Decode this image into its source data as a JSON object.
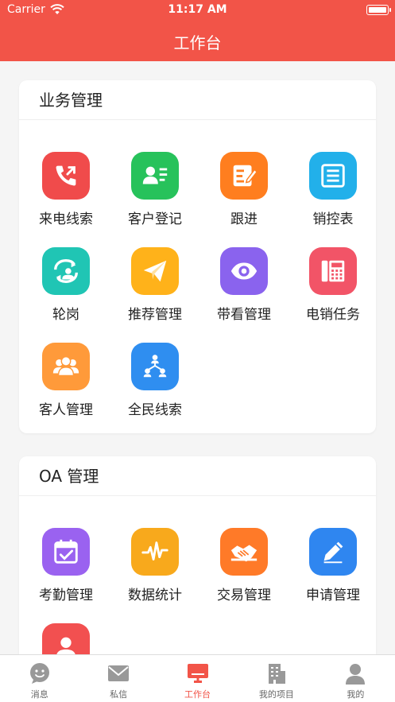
{
  "status": {
    "carrier": "Carrier",
    "time": "11:17 AM"
  },
  "header": {
    "title": "工作台"
  },
  "business": {
    "title": "业务管理",
    "items": [
      {
        "label": "来电线索",
        "icon": "phone-icon",
        "color": "#f04b4b"
      },
      {
        "label": "客户登记",
        "icon": "contact-card-icon",
        "color": "#27c25b"
      },
      {
        "label": "跟进",
        "icon": "edit-note-icon",
        "color": "#ff7e1f"
      },
      {
        "label": "销控表",
        "icon": "list-doc-icon",
        "color": "#22b0ea"
      },
      {
        "label": "轮岗",
        "icon": "rotate-user-icon",
        "color": "#20c5b4"
      },
      {
        "label": "推荐管理",
        "icon": "paper-plane-icon",
        "color": "#ffb21a"
      },
      {
        "label": "带看管理",
        "icon": "eye-icon",
        "color": "#8a63ee"
      },
      {
        "label": "电销任务",
        "icon": "desk-phone-icon",
        "color": "#f25467"
      },
      {
        "label": "客人管理",
        "icon": "group-icon",
        "color": "#ff9a3a"
      },
      {
        "label": "全民线索",
        "icon": "network-icon",
        "color": "#2f8ef0"
      }
    ]
  },
  "oa": {
    "title": "OA 管理",
    "items": [
      {
        "label": "考勤管理",
        "icon": "calendar-check-icon",
        "color": "#9a62f0"
      },
      {
        "label": "数据统计",
        "icon": "pulse-icon",
        "color": "#f8a91c"
      },
      {
        "label": "交易管理",
        "icon": "handshake-icon",
        "color": "#ff7a28"
      },
      {
        "label": "申请管理",
        "icon": "pencil-icon",
        "color": "#2f86f0"
      },
      {
        "label": "",
        "icon": "person-badge-icon",
        "color": "#f25050"
      }
    ]
  },
  "tabs": [
    {
      "label": "消息",
      "icon": "chat-bubble-icon",
      "active": false
    },
    {
      "label": "私信",
      "icon": "mail-icon",
      "active": false
    },
    {
      "label": "工作台",
      "icon": "monitor-icon",
      "active": true
    },
    {
      "label": "我的项目",
      "icon": "building-icon",
      "active": false
    },
    {
      "label": "我的",
      "icon": "user-icon",
      "active": false
    }
  ],
  "colors": {
    "accent": "#f25448",
    "inactive_tab": "#999999"
  }
}
